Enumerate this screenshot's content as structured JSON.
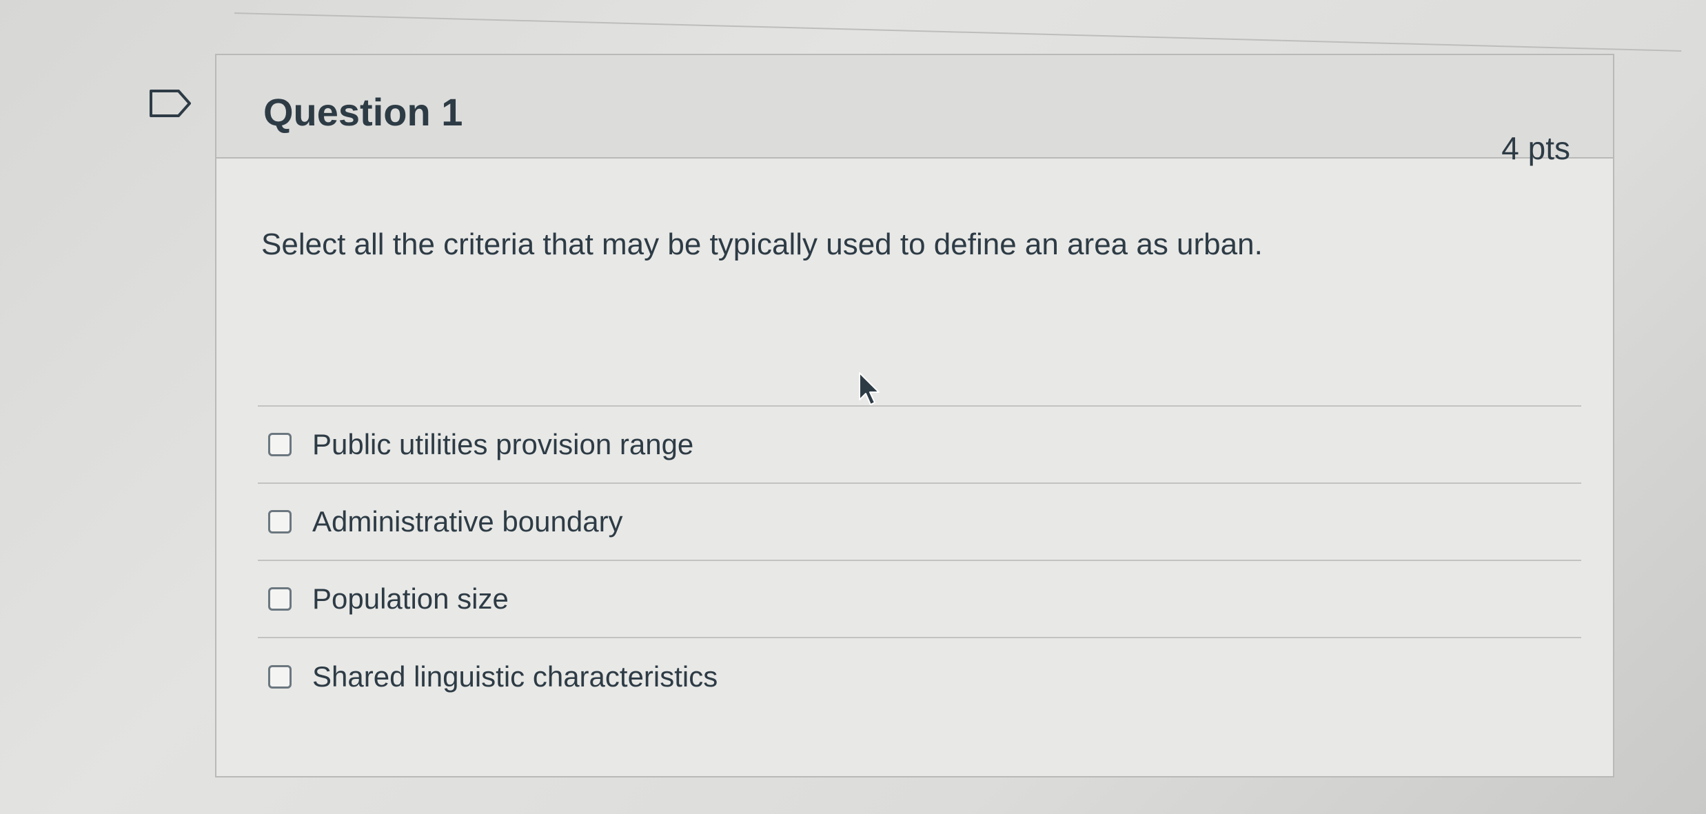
{
  "question": {
    "title": "Question 1",
    "points": "4 pts",
    "text": "Select all the criteria that may be typically used to define an area as urban."
  },
  "answers": [
    {
      "label": "Public utilities provision range",
      "checked": false
    },
    {
      "label": "Administrative boundary",
      "checked": false
    },
    {
      "label": "Population size",
      "checked": false
    },
    {
      "label": "Shared linguistic characteristics",
      "checked": false
    }
  ],
  "icons": {
    "flag": "flag-question-icon",
    "cursor": "mouse-cursor-icon",
    "checkbox": "checkbox-unchecked-icon"
  },
  "colors": {
    "text": "#2d3b45",
    "border": "#b9b9b7",
    "header_bg": "#dcdcda",
    "card_bg": "#e8e8e6"
  }
}
